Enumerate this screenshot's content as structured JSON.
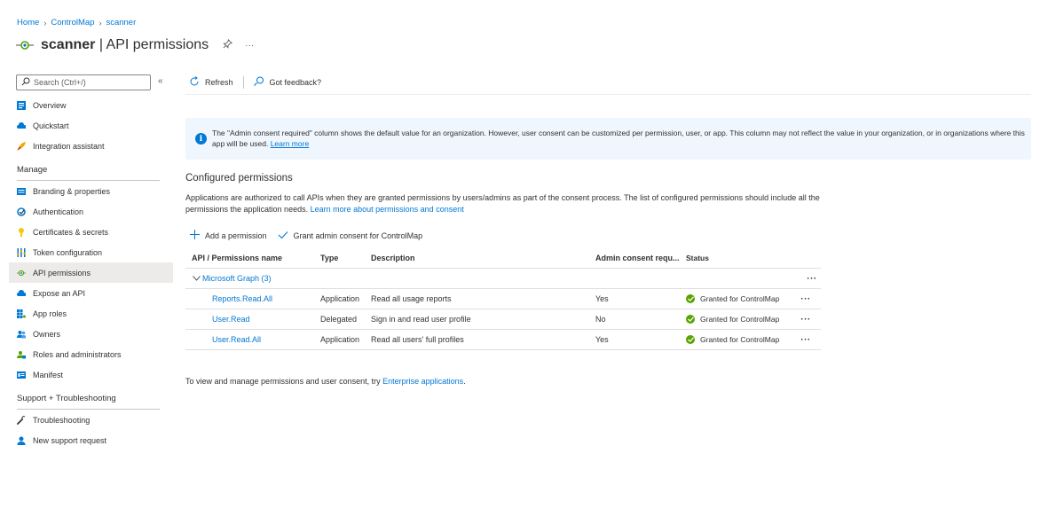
{
  "breadcrumb": {
    "home": "Home",
    "app": "ControlMap",
    "current": "scanner"
  },
  "header": {
    "app_name": "scanner",
    "separator": " | ",
    "page_name": "API permissions",
    "more": "···"
  },
  "sidebar": {
    "search_placeholder": "Search (Ctrl+/)",
    "collapse": "«",
    "top_items": [
      {
        "label": "Overview",
        "icon": "overview-icon"
      },
      {
        "label": "Quickstart",
        "icon": "quickstart-icon"
      },
      {
        "label": "Integration assistant",
        "icon": "rocket-icon"
      }
    ],
    "manage_header": "Manage",
    "manage_items": [
      {
        "label": "Branding & properties",
        "icon": "branding-icon"
      },
      {
        "label": "Authentication",
        "icon": "authentication-icon"
      },
      {
        "label": "Certificates & secrets",
        "icon": "key-icon"
      },
      {
        "label": "Token configuration",
        "icon": "token-icon"
      },
      {
        "label": "API permissions",
        "icon": "api-permissions-icon",
        "active": true
      },
      {
        "label": "Expose an API",
        "icon": "cloud-icon"
      },
      {
        "label": "App roles",
        "icon": "app-roles-icon"
      },
      {
        "label": "Owners",
        "icon": "owners-icon"
      },
      {
        "label": "Roles and administrators",
        "icon": "roles-icon"
      },
      {
        "label": "Manifest",
        "icon": "manifest-icon"
      }
    ],
    "support_header": "Support + Troubleshooting",
    "support_items": [
      {
        "label": "Troubleshooting",
        "icon": "wrench-icon"
      },
      {
        "label": "New support request",
        "icon": "support-icon"
      }
    ]
  },
  "toolbar": {
    "refresh": "Refresh",
    "feedback": "Got feedback?"
  },
  "banner": {
    "text": "The \"Admin consent required\" column shows the default value for an organization. However, user consent can be customized per permission, user, or app. This column may not reflect the value in your organization, or in organizations where this app will be used.",
    "link": "Learn more"
  },
  "configured": {
    "title": "Configured permissions",
    "desc": "Applications are authorized to call APIs when they are granted permissions by users/admins as part of the consent process. The list of configured permissions should include all the permissions the application needs.",
    "desc_link": "Learn more about permissions and consent",
    "add": "Add a permission",
    "grant": "Grant admin consent for ControlMap"
  },
  "table": {
    "headers": {
      "name": "API / Permissions name",
      "type": "Type",
      "description": "Description",
      "admin": "Admin consent requ...",
      "status": "Status"
    },
    "group": "Microsoft Graph (3)",
    "group_more": "···",
    "rows": [
      {
        "name": "Reports.Read.All",
        "type": "Application",
        "description": "Read all usage reports",
        "admin": "Yes",
        "status": "Granted for ControlMap",
        "more": "···"
      },
      {
        "name": "User.Read",
        "type": "Delegated",
        "description": "Sign in and read user profile",
        "admin": "No",
        "status": "Granted for ControlMap",
        "more": "···"
      },
      {
        "name": "User.Read.All",
        "type": "Application",
        "description": "Read all users' full profiles",
        "admin": "Yes",
        "status": "Granted for ControlMap",
        "more": "···"
      }
    ]
  },
  "footer": {
    "text": "To view and manage permissions and user consent, try ",
    "link": "Enterprise applications",
    "end": "."
  }
}
